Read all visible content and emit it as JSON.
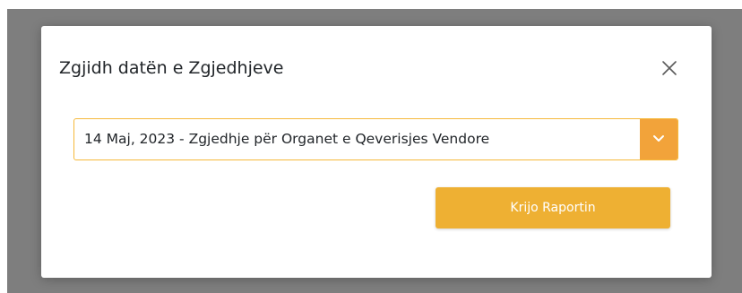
{
  "modal": {
    "title": "Zgjidh datën e Zgjedhjeve",
    "close_icon": "close-icon",
    "election_select": {
      "selected_value": "14 Maj, 2023 - Zgjedhje për Organet e Qeverisjes Vendore",
      "arrow_icon": "chevron-down-icon"
    },
    "create_button_label": "Krijo Raportin"
  },
  "colors": {
    "backdrop": "#7e7e7e",
    "accent": "#eeb033",
    "select_arrow": "#f2a33a",
    "select_border": "#f6b93b"
  }
}
